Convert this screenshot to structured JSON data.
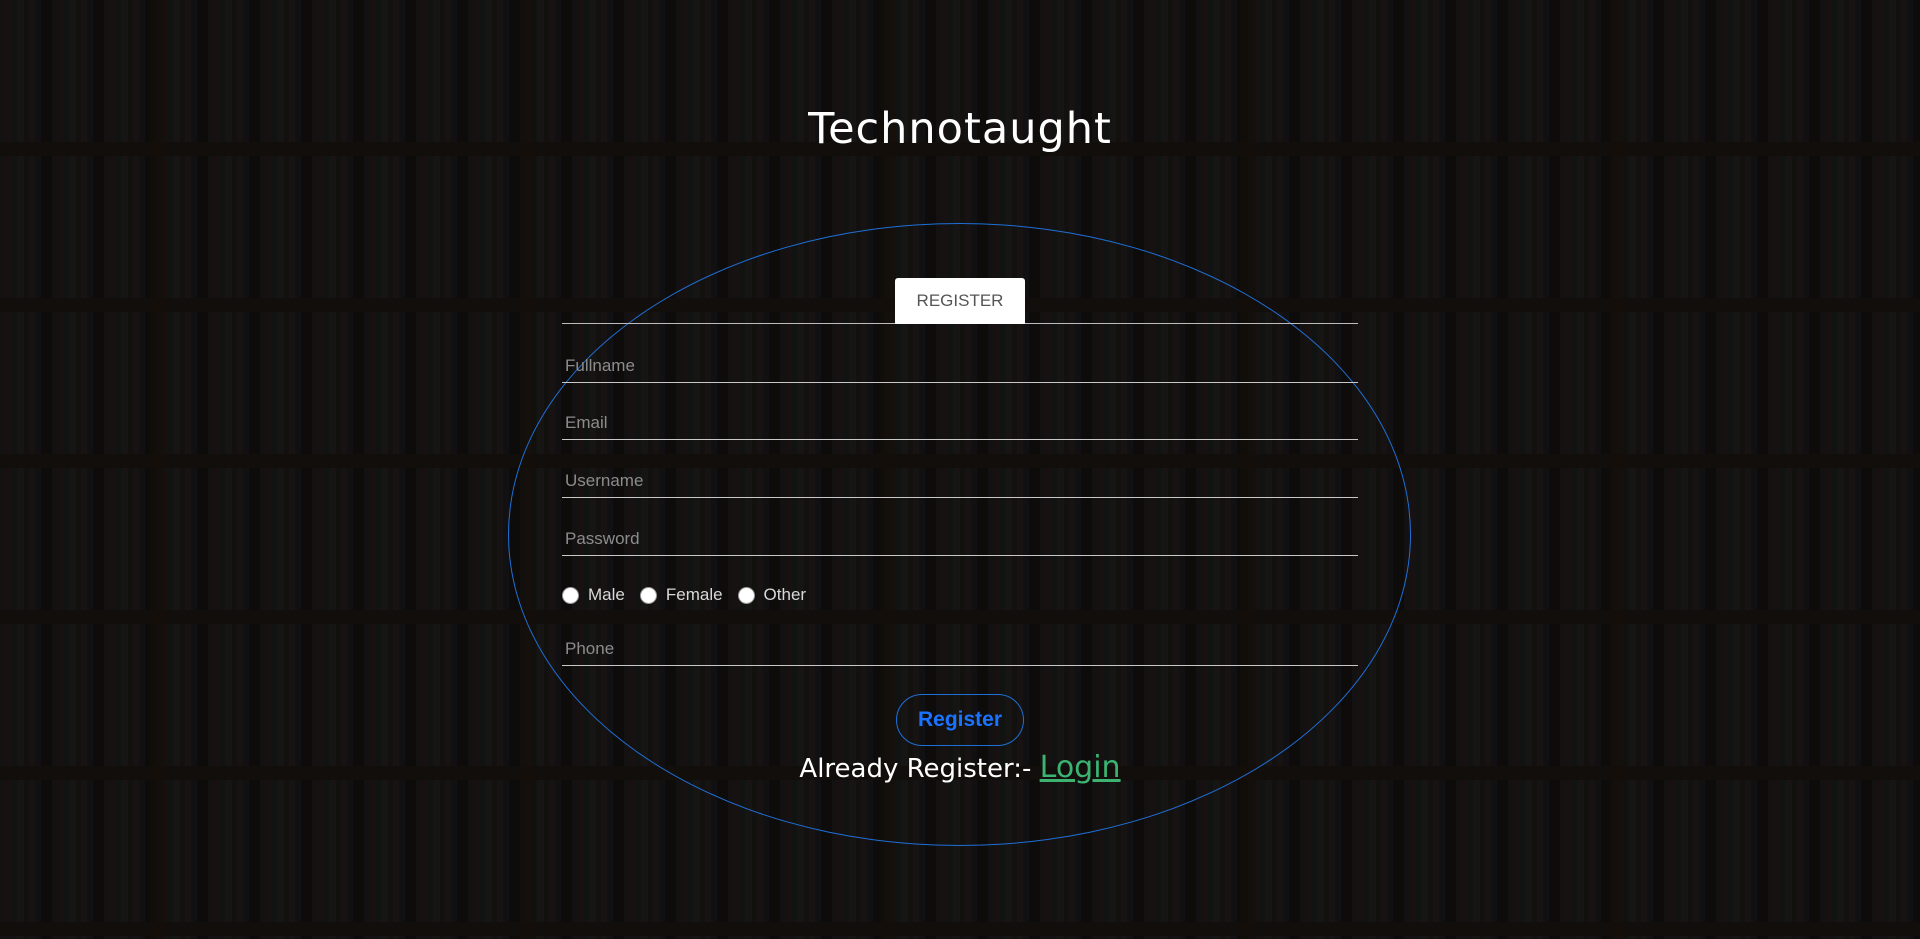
{
  "brand": {
    "title": "Technotaught"
  },
  "tab": {
    "label": "REGISTER"
  },
  "form": {
    "fullname_placeholder": "Fullname",
    "email_placeholder": "Email",
    "username_placeholder": "Username",
    "password_placeholder": "Password",
    "phone_placeholder": "Phone",
    "gender_options": [
      "Male",
      "Female",
      "Other"
    ],
    "submit_label": "Register"
  },
  "footer": {
    "prompt": "Already Register:- ",
    "login_link": "Login"
  },
  "colors": {
    "accent_blue": "#1a73ff",
    "border_blue": "#1f6fd6",
    "link_green": "#3cb371"
  }
}
